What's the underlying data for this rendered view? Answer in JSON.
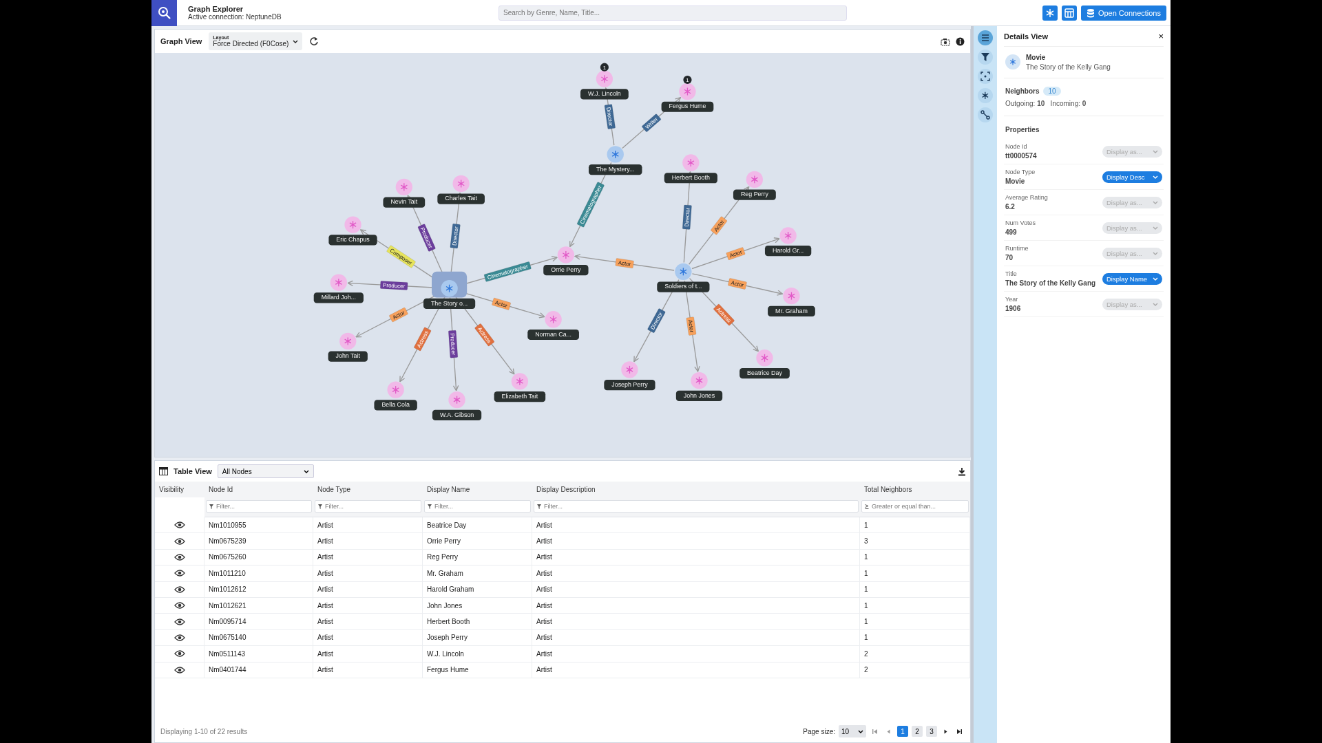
{
  "header": {
    "title": "Graph Explorer",
    "subtitle": "Active connection: NeptuneDB",
    "search": {
      "placeholder": "Search by Genre, Name, Title..."
    },
    "view_toggles": [
      {
        "kind": "graph",
        "on": true
      },
      {
        "kind": "table",
        "on": true
      }
    ],
    "connections_button": "Open Connections"
  },
  "graph_view": {
    "title": "Graph View",
    "layout_label": "Layout",
    "layout_value": "Force Directed (F0Cose)",
    "nodes": [
      {
        "label": "The Story o...",
        "kind": "movie",
        "selected": true
      },
      {
        "label": "The Mystery...",
        "kind": "movie",
        "selected": false
      },
      {
        "label": "Soldiers of t...",
        "kind": "movie",
        "selected": false
      },
      {
        "label": "W.J. Lincoln",
        "kind": "artist",
        "selected": false,
        "badge": "1"
      },
      {
        "label": "Fergus Hume",
        "kind": "artist",
        "selected": false,
        "badge": "1"
      },
      {
        "label": "Nevin Tait",
        "kind": "artist",
        "selected": false
      },
      {
        "label": "Charles Tait",
        "kind": "artist",
        "selected": false
      },
      {
        "label": "Eric Chapus",
        "kind": "artist",
        "selected": false
      },
      {
        "label": "Millard Joh...",
        "kind": "artist",
        "selected": false
      },
      {
        "label": "Orrie Perry",
        "kind": "artist",
        "selected": false
      },
      {
        "label": "Norman Ca...",
        "kind": "artist",
        "selected": false
      },
      {
        "label": "John Tait",
        "kind": "artist",
        "selected": false
      },
      {
        "label": "Bella Cola",
        "kind": "artist",
        "selected": false
      },
      {
        "label": "W.A. Gibson",
        "kind": "artist",
        "selected": false
      },
      {
        "label": "Elizabeth Tait",
        "kind": "artist",
        "selected": false
      },
      {
        "label": "Herbert Booth",
        "kind": "artist",
        "selected": false
      },
      {
        "label": "Reg Perry",
        "kind": "artist",
        "selected": false
      },
      {
        "label": "Harold Gr...",
        "kind": "artist",
        "selected": false
      },
      {
        "label": "Mr. Graham",
        "kind": "artist",
        "selected": false
      },
      {
        "label": "Beatrice Day",
        "kind": "artist",
        "selected": false
      },
      {
        "label": "John Jones",
        "kind": "artist",
        "selected": false
      },
      {
        "label": "Joseph Perry",
        "kind": "artist",
        "selected": false
      }
    ],
    "edges": [
      {
        "label": "Composer",
        "color": "#e6e35c"
      },
      {
        "label": "Producer",
        "color": "#6b3d9c"
      },
      {
        "label": "Director",
        "color": "#3e6894"
      },
      {
        "label": "Producer",
        "color": "#6b3d9c"
      },
      {
        "label": "Cinematographer",
        "color": "#3b8a94"
      },
      {
        "label": "Actor",
        "color": "#f7a15c"
      },
      {
        "label": "Actor",
        "color": "#f7a15c"
      },
      {
        "label": "Actress",
        "color": "#e0703f"
      },
      {
        "label": "Producer",
        "color": "#6b3d9c"
      },
      {
        "label": "Actress",
        "color": "#e0703f"
      },
      {
        "label": "Director",
        "color": "#3e6894"
      },
      {
        "label": "Writer",
        "color": "#3e6894"
      },
      {
        "label": "Cinematographer",
        "color": "#3b8a94"
      },
      {
        "label": "Director",
        "color": "#3e6894"
      },
      {
        "label": "Actor",
        "color": "#f7a15c"
      },
      {
        "label": "Actor",
        "color": "#f7a15c"
      },
      {
        "label": "Actor",
        "color": "#f7a15c"
      },
      {
        "label": "Actress",
        "color": "#e0703f"
      },
      {
        "label": "Actor",
        "color": "#f7a15c"
      },
      {
        "label": "Director",
        "color": "#3e6894"
      },
      {
        "label": "Actor",
        "color": "#f7a15c"
      }
    ]
  },
  "table_view": {
    "title": "Table View",
    "select_value": "All Nodes",
    "visibility_column": "Visibility",
    "columns": [
      "Node Id",
      "Node Type",
      "Display Name",
      "Display Description",
      "Total Neighbors"
    ],
    "filters": [
      {
        "kind": "text",
        "placeholder": "Filter..."
      },
      {
        "kind": "text",
        "placeholder": "Filter..."
      },
      {
        "kind": "text",
        "placeholder": "Filter..."
      },
      {
        "kind": "text",
        "placeholder": "Filter..."
      },
      {
        "kind": "number",
        "placeholder": "Greater or equal than..."
      }
    ],
    "rows": [
      {
        "visible": true,
        "cells": [
          "Nm1010955",
          "Artist",
          "Beatrice Day",
          "Artist",
          "1"
        ]
      },
      {
        "visible": true,
        "cells": [
          "Nm0675239",
          "Artist",
          "Orrie Perry",
          "Artist",
          "3"
        ]
      },
      {
        "visible": true,
        "cells": [
          "Nm0675260",
          "Artist",
          "Reg Perry",
          "Artist",
          "1"
        ]
      },
      {
        "visible": true,
        "cells": [
          "Nm1011210",
          "Artist",
          "Mr. Graham",
          "Artist",
          "1"
        ]
      },
      {
        "visible": true,
        "cells": [
          "Nm1012612",
          "Artist",
          "Harold Graham",
          "Artist",
          "1"
        ]
      },
      {
        "visible": true,
        "cells": [
          "Nm1012621",
          "Artist",
          "John Jones",
          "Artist",
          "1"
        ]
      },
      {
        "visible": true,
        "cells": [
          "Nm0095714",
          "Artist",
          "Herbert Booth",
          "Artist",
          "1"
        ]
      },
      {
        "visible": true,
        "cells": [
          "Nm0675140",
          "Artist",
          "Joseph Perry",
          "Artist",
          "1"
        ]
      },
      {
        "visible": true,
        "cells": [
          "Nm0511143",
          "Artist",
          "W.J. Lincoln",
          "Artist",
          "2"
        ]
      },
      {
        "visible": true,
        "cells": [
          "Nm0401744",
          "Artist",
          "Fergus Hume",
          "Artist",
          "2"
        ]
      }
    ],
    "footer": {
      "summary": "Displaying 1-10 of 22 results",
      "page_size_label": "Page size:",
      "page_size": "10",
      "pages": [
        {
          "label": "1",
          "selected": true
        },
        {
          "label": "2",
          "selected": false
        },
        {
          "label": "3",
          "selected": false
        }
      ]
    }
  },
  "sidebar_tools": [
    {
      "kind": "details",
      "selected": true
    },
    {
      "kind": "filter",
      "selected": false
    },
    {
      "kind": "expand",
      "selected": false
    },
    {
      "kind": "styling",
      "selected": false
    },
    {
      "kind": "path",
      "selected": false
    }
  ],
  "details_view": {
    "title": "Details View",
    "close": "×",
    "node_type": "Movie",
    "node_name": "The Story of the Kelly Gang",
    "neighbors_label": "Neighbors",
    "neighbors_count": "10",
    "counts": "Outgoing: **10**   Incoming: **0**",
    "properties_title": "Properties",
    "properties": [
      {
        "label": "Node Id",
        "value": "tt0000574",
        "display": "Display as...",
        "active": false
      },
      {
        "label": "Node Type",
        "value": "Movie",
        "display": "Display Desc",
        "active": true
      },
      {
        "label": "Average Rating",
        "value": "6.2",
        "display": "Display as...",
        "active": false
      },
      {
        "label": "Num Votes",
        "value": "499",
        "display": "Display as...",
        "active": false
      },
      {
        "label": "Runtime",
        "value": "70",
        "display": "Display as...",
        "active": false
      },
      {
        "label": "Title",
        "value": "The Story of the Kelly Gang",
        "display": "Display Name",
        "active": true
      },
      {
        "label": "Year",
        "value": "1906",
        "display": "Display as...",
        "active": false
      }
    ]
  }
}
